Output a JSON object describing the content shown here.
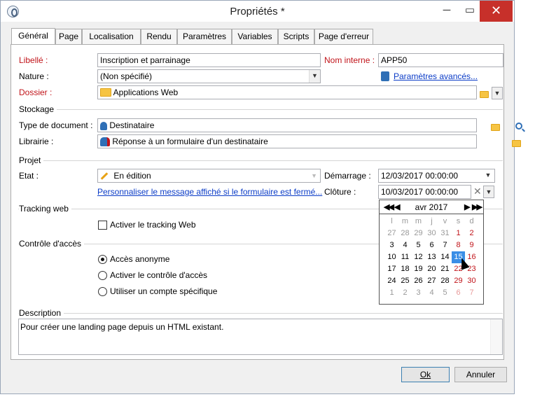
{
  "window": {
    "title": "Propriétés *",
    "min": "─",
    "max": "▭",
    "close": "✕"
  },
  "tabs": [
    "Général",
    "Page",
    "Localisation",
    "Rendu",
    "Paramètres",
    "Variables",
    "Scripts",
    "Page d'erreur"
  ],
  "fields": {
    "libelle_label": "Libellé :",
    "libelle_value": "Inscription et parrainage",
    "nom_interne_label": "Nom interne :",
    "nom_interne_value": "APP50",
    "nature_label": "Nature :",
    "nature_value": "(Non spécifié)",
    "parametres_avances": "Paramètres avancés...",
    "dossier_label": "Dossier :",
    "dossier_value": "Applications Web"
  },
  "stockage": {
    "group": "Stockage",
    "type_doc_label": "Type de document :",
    "type_doc_value": "Destinataire",
    "librairie_label": "Librairie :",
    "librairie_value": "Réponse à un formulaire d'un destinataire"
  },
  "projet": {
    "group": "Projet",
    "etat_label": "Etat :",
    "etat_value": "En édition",
    "demarrage_label": "Démarrage :",
    "demarrage_value": "12/03/2017 00:00:00",
    "cloture_label": "Clôture :",
    "cloture_value": "10/03/2017 00:00:00",
    "personnaliser_link": "Personnaliser le message affiché si le formulaire est fermé..."
  },
  "tracking": {
    "group": "Tracking web",
    "checkbox_label": "Activer le tracking Web"
  },
  "acces": {
    "group": "Contrôle d'accès",
    "options": [
      "Accès anonyme",
      "Activer le contrôle d'accès",
      "Utiliser un compte spécifique"
    ]
  },
  "description": {
    "group": "Description",
    "text": "Pour créer une landing page depuis un HTML existant."
  },
  "buttons": {
    "ok": "Ok",
    "annuler": "Annuler"
  },
  "calendar": {
    "month": "avr 2017",
    "prev_year": "◀◀",
    "prev_month": "◀",
    "next_month": "▶",
    "next_year": "▶▶",
    "weekdays": [
      "l",
      "m",
      "m",
      "j",
      "v",
      "s",
      "d"
    ],
    "weeks": [
      [
        "27",
        "28",
        "29",
        "30",
        "31",
        "1",
        "2"
      ],
      [
        "3",
        "4",
        "5",
        "6",
        "7",
        "8",
        "9"
      ],
      [
        "10",
        "11",
        "12",
        "13",
        "14",
        "15",
        "16"
      ],
      [
        "17",
        "18",
        "19",
        "20",
        "21",
        "22",
        "23"
      ],
      [
        "24",
        "25",
        "26",
        "27",
        "28",
        "29",
        "30"
      ],
      [
        "1",
        "2",
        "3",
        "4",
        "5",
        "6",
        "7"
      ]
    ],
    "selected": "15"
  }
}
